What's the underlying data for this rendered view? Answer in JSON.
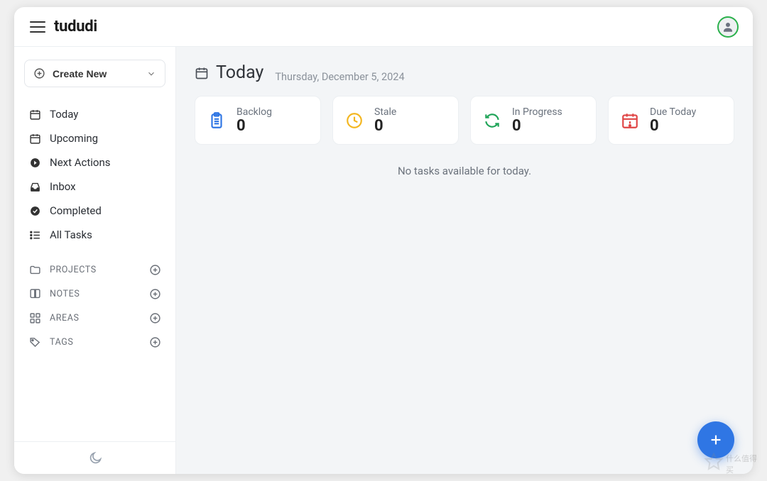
{
  "header": {
    "brand": "tududi"
  },
  "sidebar": {
    "create_label": "Create New",
    "nav": [
      {
        "label": "Today"
      },
      {
        "label": "Upcoming"
      },
      {
        "label": "Next Actions"
      },
      {
        "label": "Inbox"
      },
      {
        "label": "Completed"
      },
      {
        "label": "All Tasks"
      }
    ],
    "sections": [
      {
        "label": "PROJECTS"
      },
      {
        "label": "NOTES"
      },
      {
        "label": "AREAS"
      },
      {
        "label": "TAGS"
      }
    ]
  },
  "page": {
    "title": "Today",
    "date": "Thursday, December 5, 2024",
    "cards": [
      {
        "label": "Backlog",
        "value": "0",
        "color": "#2f76e4"
      },
      {
        "label": "Stale",
        "value": "0",
        "color": "#f3b61f"
      },
      {
        "label": "In Progress",
        "value": "0",
        "color": "#22a55a"
      },
      {
        "label": "Due Today",
        "value": "0",
        "color": "#e04646"
      }
    ],
    "empty_text": "No tasks available for today."
  },
  "watermark_text": "什么值得买"
}
